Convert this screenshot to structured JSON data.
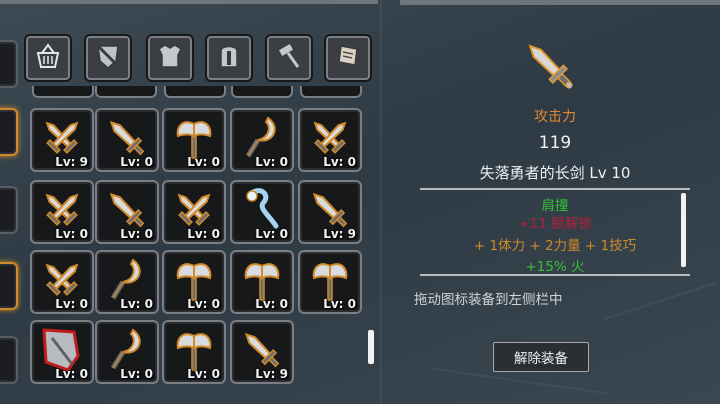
{
  "category_tabs": [
    {
      "name": "basket",
      "icon": "basket-icon"
    },
    {
      "name": "shield",
      "icon": "shield-sword-icon"
    },
    {
      "name": "armor",
      "icon": "armor-icon"
    },
    {
      "name": "helmet",
      "icon": "helmet-icon"
    },
    {
      "name": "hammer",
      "icon": "hammer-icon"
    },
    {
      "name": "scroll",
      "icon": "scroll-icon"
    }
  ],
  "inventory": {
    "rows": [
      [
        {
          "icon": "crossed-swords-icon",
          "level": "Lv: 9"
        },
        {
          "icon": "longsword-icon",
          "level": "Lv: 0"
        },
        {
          "icon": "axe-icon",
          "level": "Lv: 0"
        },
        {
          "icon": "sickle-icon",
          "level": "Lv: 0"
        },
        {
          "icon": "crossed-swords-icon",
          "level": "Lv: 0"
        }
      ],
      [
        {
          "icon": "crossed-swords-icon",
          "level": "Lv: 0"
        },
        {
          "icon": "longsword-icon",
          "level": "Lv: 0"
        },
        {
          "icon": "crossed-swords-icon",
          "level": "Lv: 0"
        },
        {
          "icon": "ice-staff-icon",
          "level": "Lv: 0"
        },
        {
          "icon": "longsword-icon",
          "level": "Lv: 9"
        }
      ],
      [
        {
          "icon": "crossed-swords-icon",
          "level": "Lv: 0"
        },
        {
          "icon": "sickle-icon",
          "level": "Lv: 0"
        },
        {
          "icon": "axe-icon",
          "level": "Lv: 0"
        },
        {
          "icon": "axe-icon",
          "level": "Lv: 0"
        },
        {
          "icon": "axe-icon",
          "level": "Lv: 0"
        }
      ],
      [
        {
          "icon": "red-cleaver-icon",
          "level": "Lv: 0",
          "rarity": "red"
        },
        {
          "icon": "sickle-icon",
          "level": "Lv: 0"
        },
        {
          "icon": "axe-icon",
          "level": "Lv: 0"
        },
        {
          "icon": "longsword-icon",
          "level": "Lv: 9"
        }
      ]
    ]
  },
  "detail": {
    "item_icon": "longsword-icon",
    "stat_label": "攻击力",
    "stat_value": "119",
    "item_name": "失落勇者的长剑 Lv 10",
    "attributes": [
      {
        "text": "肩撞",
        "color": "#33c233"
      },
      {
        "text": "+11 额解锁",
        "color": "#b0213a"
      },
      {
        "text": "+ 1体力  + 2力量  + 1技巧",
        "color": "#d08a2a"
      },
      {
        "text": "+15% 火",
        "color": "#33c233"
      }
    ],
    "hint": "拖动图标装备到左侧栏中",
    "unequip_label": "解除装备"
  },
  "colors": {
    "accent_orange": "#d08a2a",
    "rare_red": "#c21d1d",
    "bonus_green": "#33c233"
  }
}
